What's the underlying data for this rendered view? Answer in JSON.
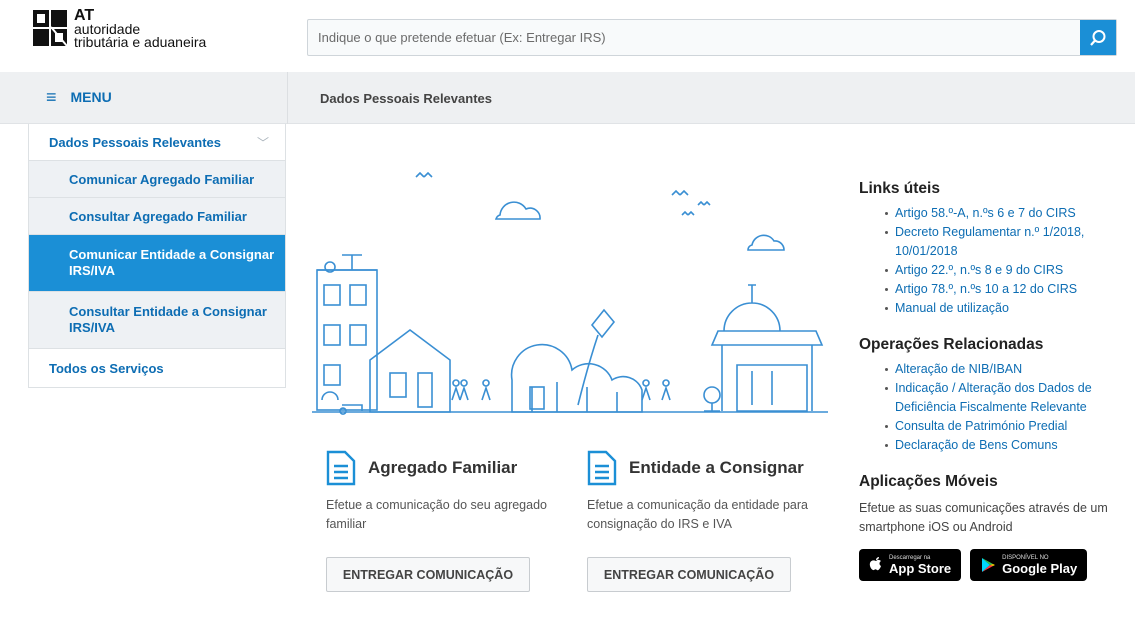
{
  "logo": {
    "line1": "AT",
    "line2": "autoridade",
    "line3": "tributária e aduaneira"
  },
  "search": {
    "placeholder": "Indique o que pretende efetuar (Ex: Entregar IRS)"
  },
  "menu": {
    "label": "MENU"
  },
  "breadcrumb": "Dados Pessoais Relevantes",
  "sidebar": {
    "top": "Dados Pessoais Relevantes",
    "items": [
      {
        "label": "Comunicar Agregado Familiar"
      },
      {
        "label": "Consultar Agregado Familiar"
      },
      {
        "label": "Comunicar Entidade a Consignar IRS/IVA",
        "active": true
      },
      {
        "label": "Consultar Entidade a Consignar IRS/IVA"
      }
    ],
    "bottom": "Todos os Serviços"
  },
  "cards": [
    {
      "title": "Agregado Familiar",
      "desc": "Efetue a comunicação do seu agregado familiar",
      "button": "ENTREGAR COMUNICAÇÃO"
    },
    {
      "title": "Entidade a Consignar",
      "desc": "Efetue a comunicação da entidade para consignação do IRS e IVA",
      "button": "ENTREGAR COMUNICAÇÃO"
    }
  ],
  "links_uteis": {
    "title": "Links úteis",
    "items": [
      "Artigo 58.º-A, n.ºs 6 e 7 do CIRS",
      "Decreto Regulamentar n.º 1/2018, 10/01/2018",
      "Artigo 22.º, n.ºs 8 e 9 do CIRS",
      "Artigo 78.º, n.ºs 10 a 12 do CIRS",
      "Manual de utilização"
    ]
  },
  "operacoes": {
    "title": "Operações Relacionadas",
    "items": [
      "Alteração de NIB/IBAN",
      "Indicação / Alteração dos Dados de Deficiência Fiscalmente Relevante",
      "Consulta de Património Predial",
      "Declaração de Bens Comuns"
    ]
  },
  "apps": {
    "title": "Aplicações Móveis",
    "desc": "Efetue as suas comunicações através de um smartphone iOS ou Android",
    "appstore_small": "Descarregar na",
    "appstore": "App Store",
    "googleplay_small": "DISPONÍVEL NO",
    "googleplay": "Google Play"
  },
  "colors": {
    "accent": "#1b8fd6",
    "link": "#0d6db3"
  }
}
